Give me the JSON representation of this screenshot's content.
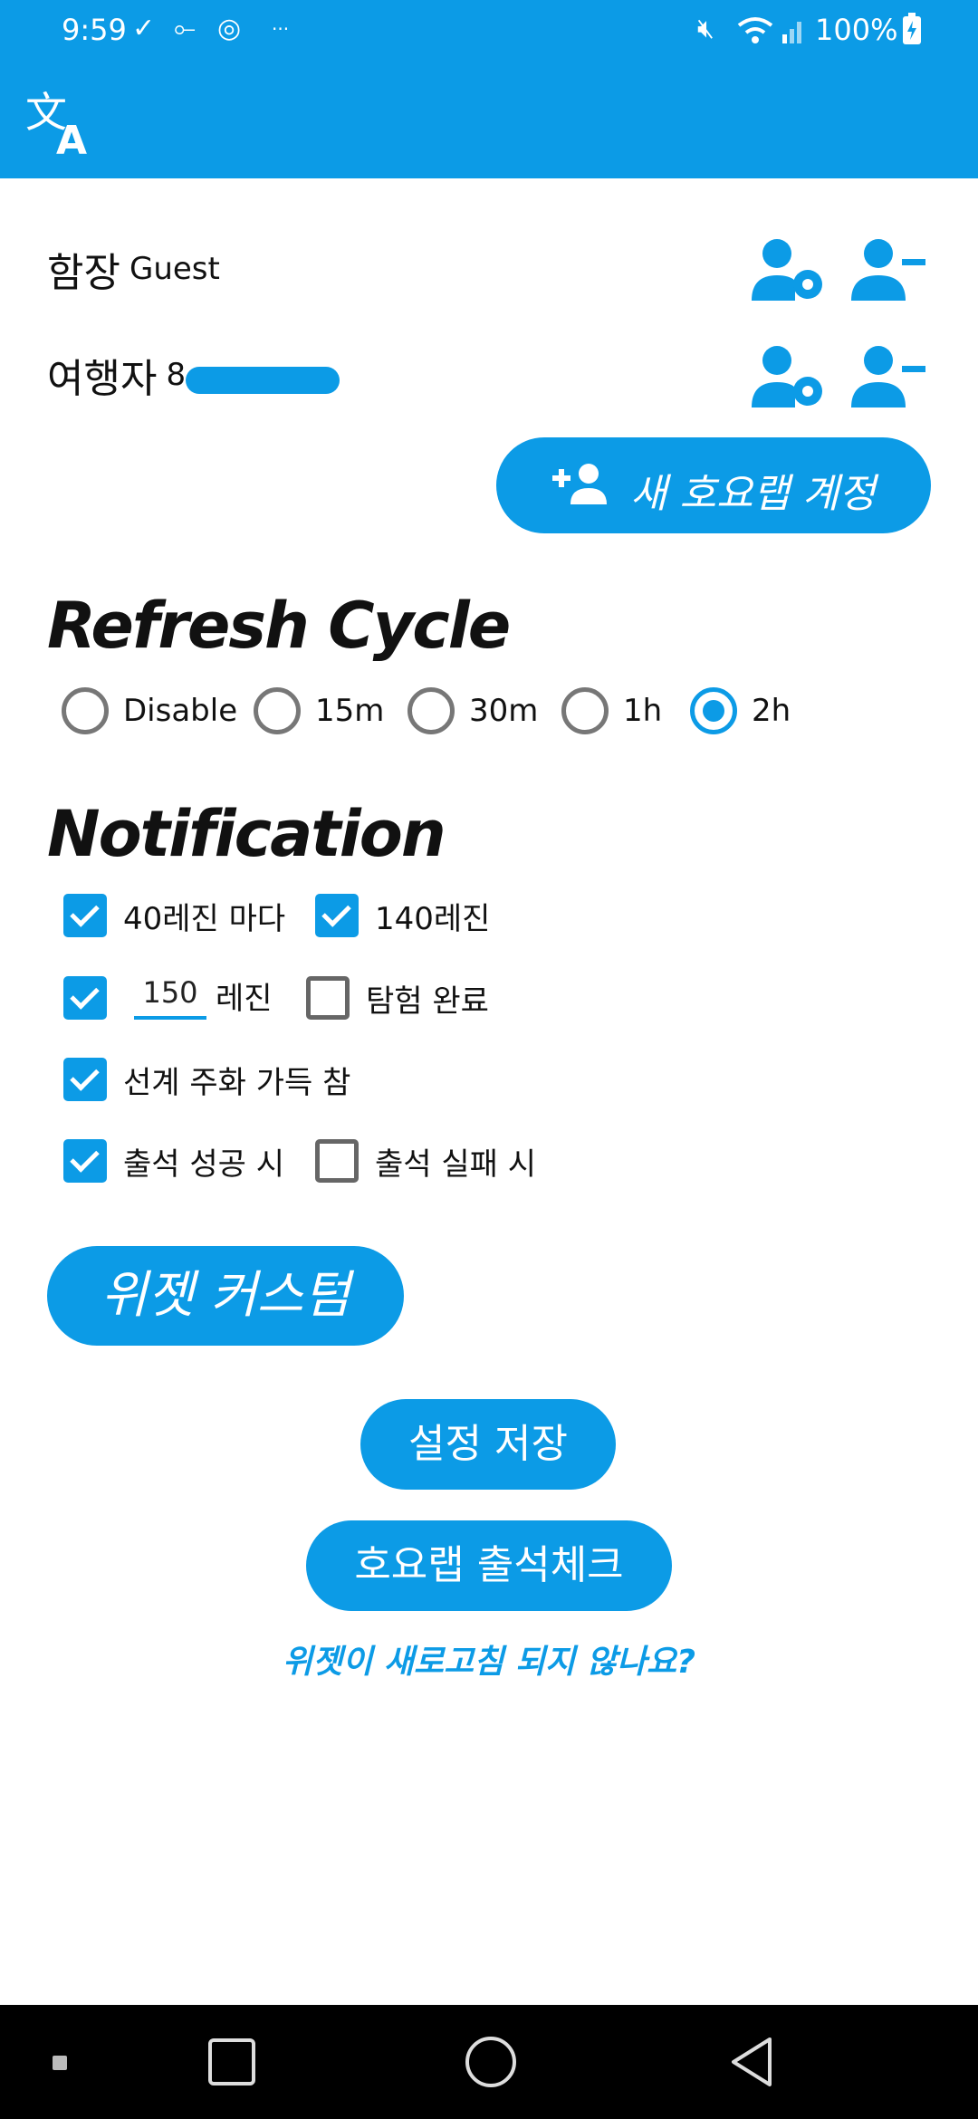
{
  "status_bar": {
    "time": "9:59",
    "battery": "100%"
  },
  "accounts": [
    {
      "role": "함장",
      "name": "Guest"
    },
    {
      "role": "여행자",
      "name": "8"
    }
  ],
  "new_account_button": "새 호요랩 계정",
  "refresh": {
    "title": "Refresh Cycle",
    "options": [
      "Disable",
      "15m",
      "30m",
      "1h",
      "2h"
    ],
    "selected": "2h"
  },
  "notification": {
    "title": "Notification",
    "items": [
      {
        "label": "40레진 마다",
        "checked": true
      },
      {
        "label": "140레진",
        "checked": true
      },
      {
        "label": "레진",
        "checked": true,
        "value": "150"
      },
      {
        "label": "탐험 완료",
        "checked": false
      },
      {
        "label": "선계 주화 가득 참",
        "checked": true
      },
      {
        "label": "출석 성공 시",
        "checked": true
      },
      {
        "label": "출석 실패 시",
        "checked": false
      }
    ]
  },
  "buttons": {
    "widget_custom": "위젯 커스텀",
    "save_settings": "설정 저장",
    "checkin": "호요랩 출석체크"
  },
  "help_link": "위젯이 새로고침 되지 않나요?",
  "colors": {
    "accent": "#0c9be6",
    "navbar": "#000000"
  }
}
